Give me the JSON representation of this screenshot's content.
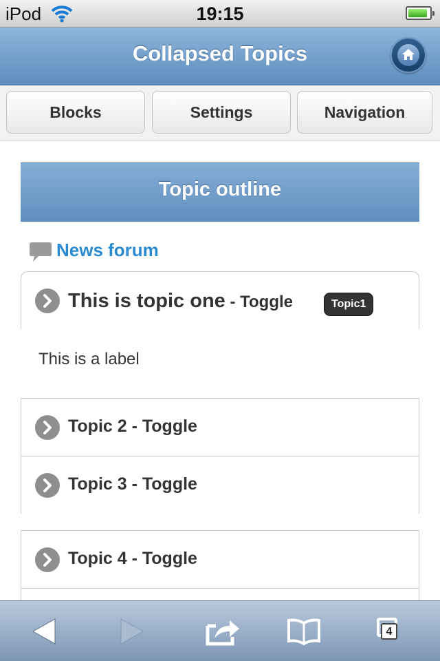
{
  "status_bar": {
    "carrier": "iPod",
    "time": "19:15",
    "battery_level": 0.9
  },
  "header": {
    "title": "Collapsed Topics",
    "home_icon": "home-icon"
  },
  "nav_buttons": [
    "Blocks",
    "Settings",
    "Navigation"
  ],
  "main": {
    "section_title": "Topic outline",
    "forum_link": "News forum",
    "topic1": {
      "title": "This is topic one",
      "toggle": " - Toggle",
      "badge": "Topic1"
    },
    "label": "This is a label",
    "topics": [
      "Topic 2 - Toggle",
      "Topic 3 - Toggle",
      "Topic 4 - Toggle"
    ]
  },
  "toolbar": {
    "tabs_count": "4"
  },
  "colors": {
    "header": "#6b98c8",
    "link": "#2a8ad0",
    "toolbar": "#9bb0c9"
  }
}
